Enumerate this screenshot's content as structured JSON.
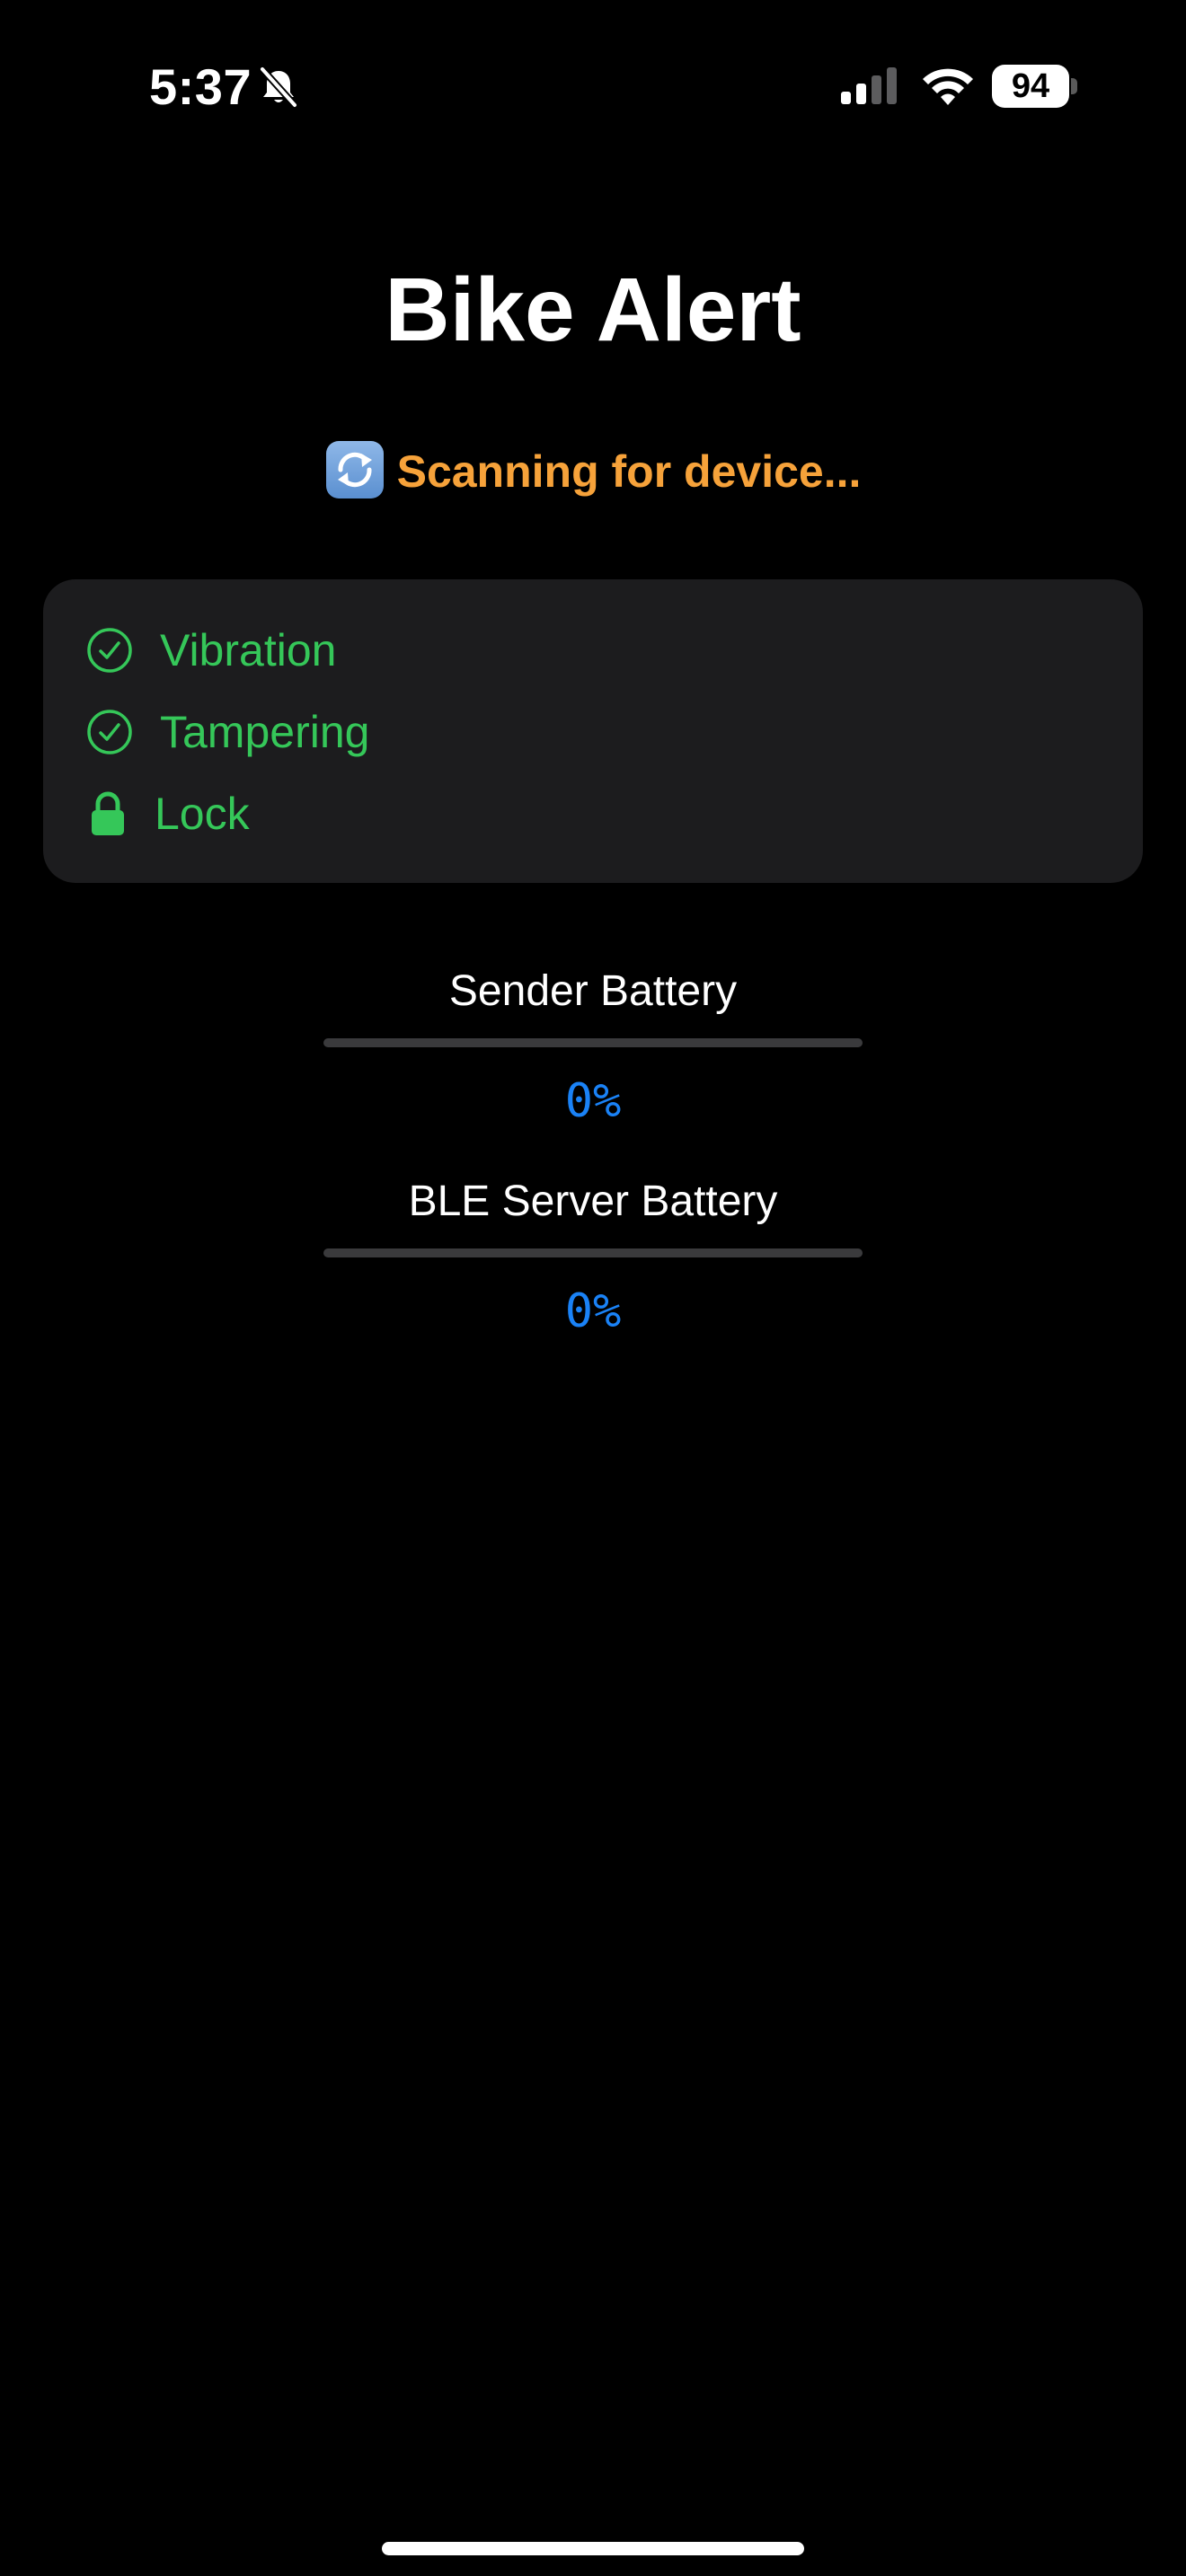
{
  "status_bar": {
    "time": "5:37",
    "battery_level": "94",
    "icons": [
      "bell-slash-icon",
      "cellular-signal-icon",
      "wifi-icon",
      "battery-icon"
    ]
  },
  "header": {
    "title": "Bike Alert",
    "scan_status": "Scanning for device...",
    "scan_icon": "sync-icon"
  },
  "alerts": {
    "items": [
      {
        "label": "Vibration",
        "icon": "checkmark-circle-icon"
      },
      {
        "label": "Tampering",
        "icon": "checkmark-circle-icon"
      },
      {
        "label": "Lock",
        "icon": "lock-icon"
      }
    ]
  },
  "batteries": [
    {
      "label": "Sender Battery",
      "percent_text": "0%",
      "level": 0
    },
    {
      "label": "BLE Server Battery",
      "percent_text": "0%",
      "level": 0
    }
  ],
  "colors": {
    "background": "#000000",
    "card": "#1c1c1e",
    "ok_green": "#35c759",
    "scanning_orange": "#f6a23a",
    "accent_blue": "#1a82f6",
    "track_gray": "#3a3a3c"
  }
}
